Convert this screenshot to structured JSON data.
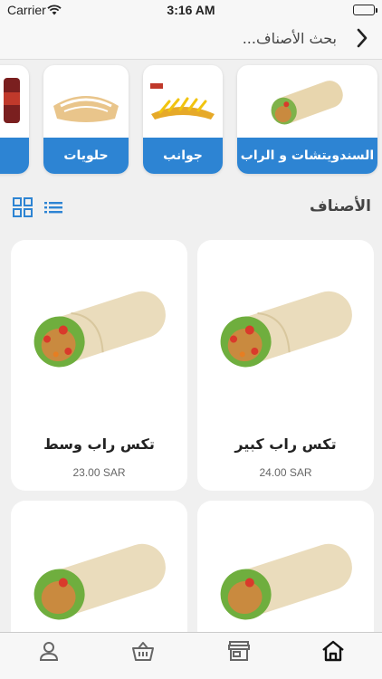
{
  "status_bar": {
    "carrier": "Carrier",
    "time": "3:16 AM"
  },
  "search": {
    "placeholder": "بحث الأصناف..."
  },
  "categories": [
    {
      "label": "السندويتشات و الراب"
    },
    {
      "label": "جوانب"
    },
    {
      "label": "حلويات"
    },
    {
      "label": ""
    }
  ],
  "section": {
    "title": "الأصناف"
  },
  "products": [
    {
      "name": "تكس راب كبير",
      "price": "24.00 SAR"
    },
    {
      "name": "تكس راب وسط",
      "price": "23.00 SAR"
    },
    {
      "name": "",
      "price": ""
    },
    {
      "name": "",
      "price": ""
    }
  ],
  "colors": {
    "accent": "#2d84d3",
    "background": "#f0f0f0"
  },
  "icons": {
    "back": "chevron-right-icon",
    "grid_view": "grid-icon",
    "list_view": "list-icon",
    "tabs": [
      "home-icon",
      "store-icon",
      "basket-icon",
      "profile-icon"
    ]
  }
}
